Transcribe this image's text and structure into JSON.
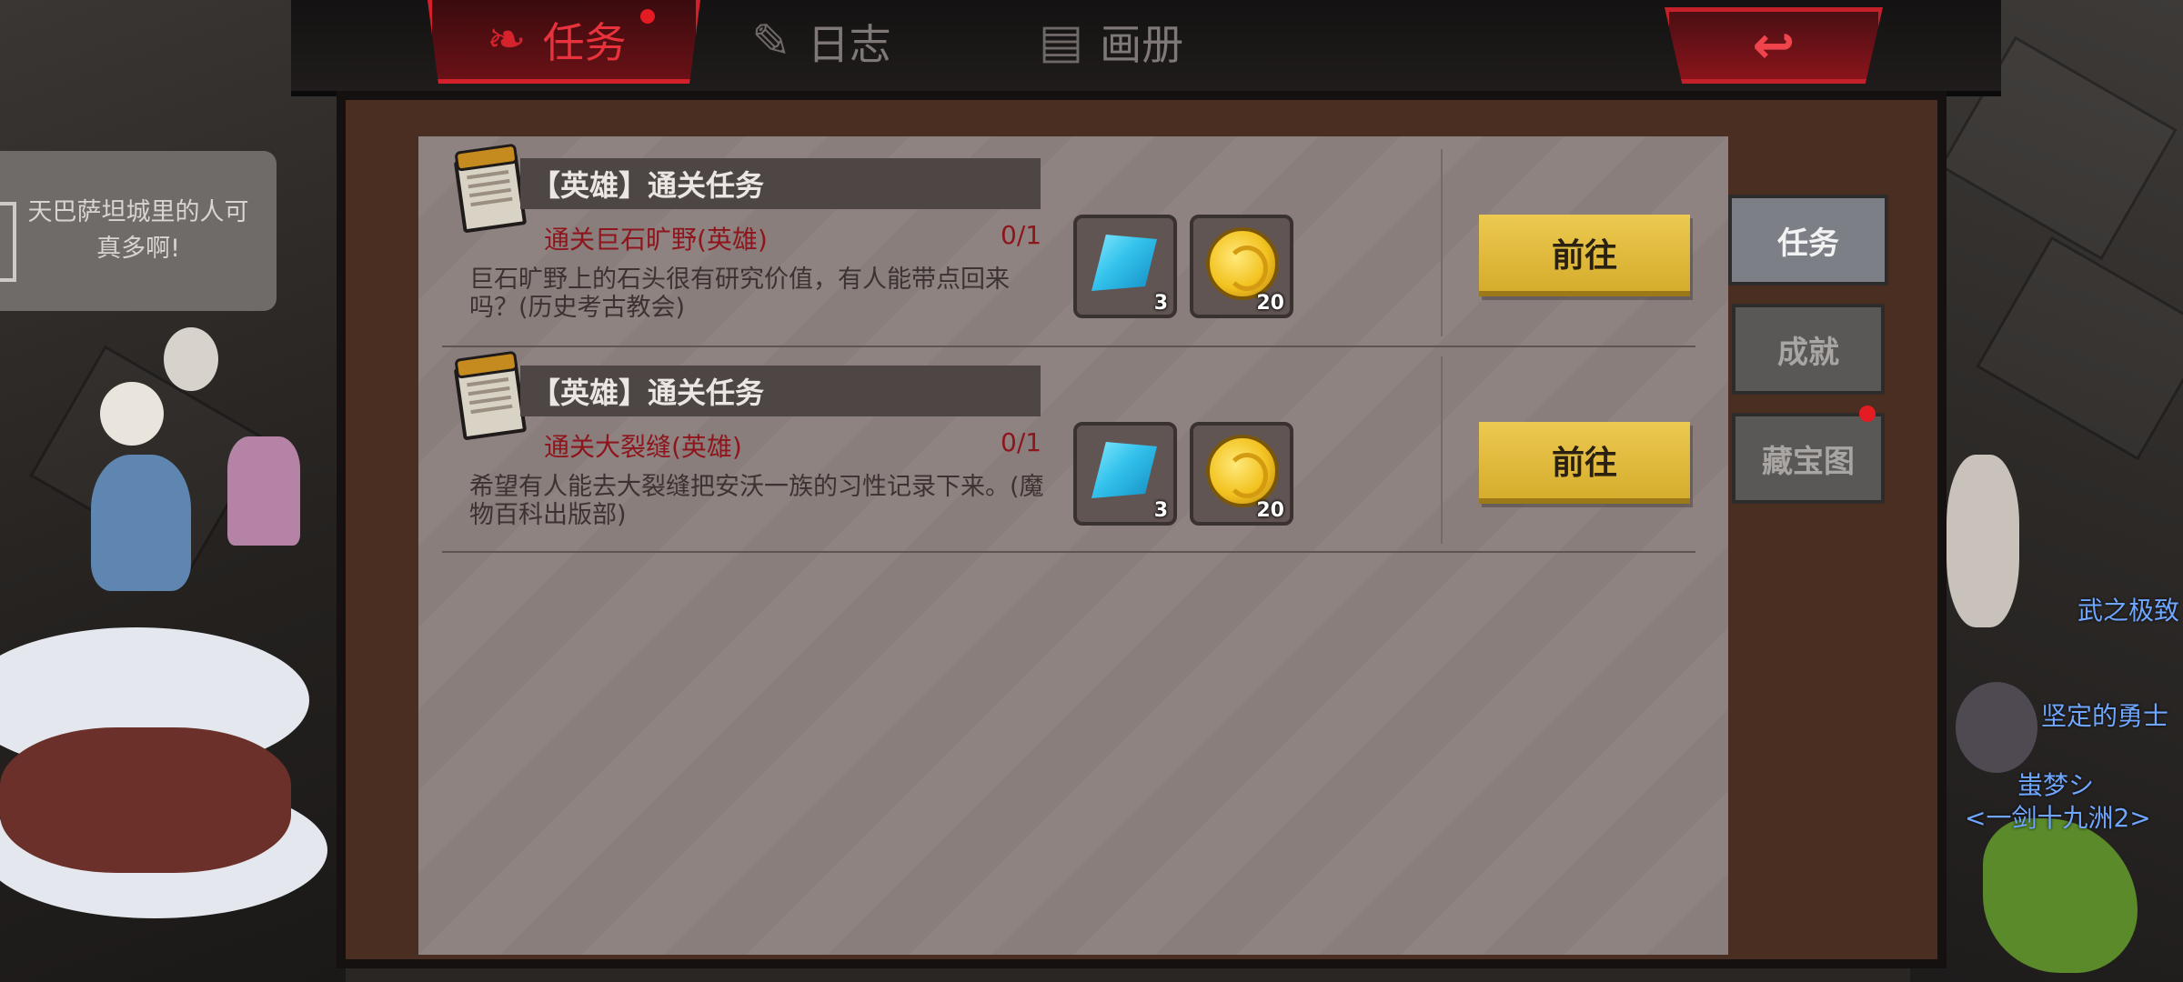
{
  "tabs": [
    {
      "label": "任务",
      "active": true
    },
    {
      "label": "日志",
      "active": false
    },
    {
      "label": "画册",
      "active": false
    }
  ],
  "back_icon": "back-arrow-icon",
  "npc_speech": "天巴萨坦城里的人可真多啊!",
  "quests": [
    {
      "title": "【英雄】通关任务",
      "condition": "通关巨石旷野(英雄)",
      "progress": "0/1",
      "description": "巨石旷野上的石头很有研究价值，有人能带点回来吗？(历史考古教会)",
      "rewards": [
        {
          "icon": "blue-crystal-icon",
          "count": "3"
        },
        {
          "icon": "gold-coin-icon",
          "count": "20"
        }
      ],
      "button": "前往"
    },
    {
      "title": "【英雄】通关任务",
      "condition": "通关大裂缝(英雄)",
      "progress": "0/1",
      "description": "希望有人能去大裂缝把安沃一族的习性记录下来。(魔物百科出版部)",
      "rewards": [
        {
          "icon": "blue-crystal-icon",
          "count": "3"
        },
        {
          "icon": "gold-coin-icon",
          "count": "20"
        }
      ],
      "button": "前往"
    }
  ],
  "side_tabs": [
    {
      "label": "任务",
      "active": true
    },
    {
      "label": "成就",
      "active": false
    },
    {
      "label": "藏宝图",
      "active": false,
      "badge": true
    }
  ],
  "player_names": [
    "武之极致",
    "坚定的勇士",
    "蚩梦シ",
    "<一剑十九洲2>"
  ],
  "colors": {
    "accent_red": "#d3202b",
    "button_yellow": "#e3bd3f",
    "condition_red": "#8e151c",
    "panel_bg": "#8a7e7c"
  }
}
